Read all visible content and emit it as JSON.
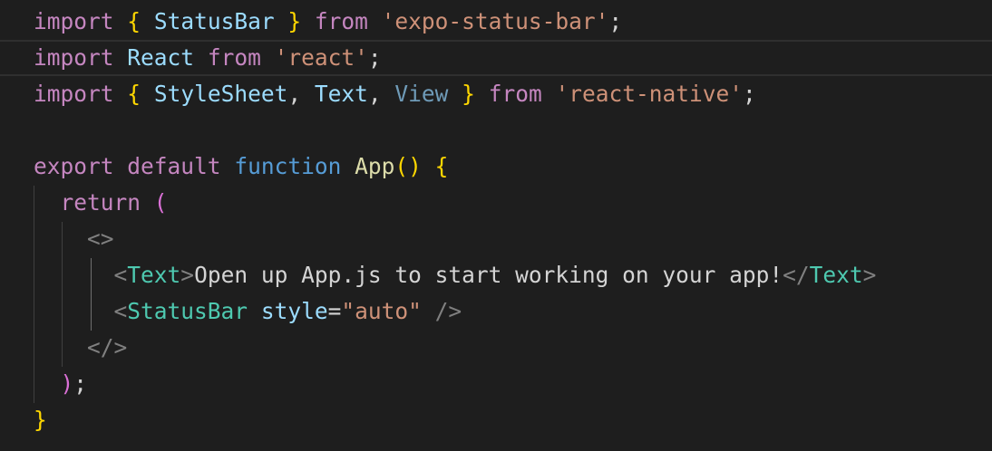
{
  "editor": {
    "language": "javascript",
    "lines": [
      {
        "tokens": [
          {
            "text": "import",
            "type": "kw"
          },
          {
            "text": " ",
            "type": "plain"
          },
          {
            "text": "{",
            "type": "br1"
          },
          {
            "text": " ",
            "type": "plain"
          },
          {
            "text": "StatusBar",
            "type": "var"
          },
          {
            "text": " ",
            "type": "plain"
          },
          {
            "text": "}",
            "type": "br1"
          },
          {
            "text": " ",
            "type": "plain"
          },
          {
            "text": "from",
            "type": "kw"
          },
          {
            "text": " ",
            "type": "plain"
          },
          {
            "text": "'expo-status-bar'",
            "type": "str"
          },
          {
            "text": ";",
            "type": "plain"
          }
        ]
      },
      {
        "tokens": [
          {
            "text": "import",
            "type": "kw"
          },
          {
            "text": " ",
            "type": "plain"
          },
          {
            "text": "React",
            "type": "var"
          },
          {
            "text": " ",
            "type": "plain"
          },
          {
            "text": "from",
            "type": "kw"
          },
          {
            "text": " ",
            "type": "plain"
          },
          {
            "text": "'react'",
            "type": "str"
          },
          {
            "text": ";",
            "type": "plain"
          }
        ]
      },
      {
        "tokens": [
          {
            "text": "import",
            "type": "kw"
          },
          {
            "text": " ",
            "type": "plain"
          },
          {
            "text": "{",
            "type": "br1"
          },
          {
            "text": " ",
            "type": "plain"
          },
          {
            "text": "StyleSheet",
            "type": "var"
          },
          {
            "text": ", ",
            "type": "plain"
          },
          {
            "text": "Text",
            "type": "var"
          },
          {
            "text": ", ",
            "type": "plain"
          },
          {
            "text": "View",
            "type": "dim"
          },
          {
            "text": " ",
            "type": "plain"
          },
          {
            "text": "}",
            "type": "br1"
          },
          {
            "text": " ",
            "type": "plain"
          },
          {
            "text": "from",
            "type": "kw"
          },
          {
            "text": " ",
            "type": "plain"
          },
          {
            "text": "'react-native'",
            "type": "str"
          },
          {
            "text": ";",
            "type": "plain"
          }
        ]
      },
      {
        "tokens": []
      },
      {
        "tokens": [
          {
            "text": "export",
            "type": "kw"
          },
          {
            "text": " ",
            "type": "plain"
          },
          {
            "text": "default",
            "type": "kw"
          },
          {
            "text": " ",
            "type": "plain"
          },
          {
            "text": "function",
            "type": "kb"
          },
          {
            "text": " ",
            "type": "plain"
          },
          {
            "text": "App",
            "type": "fn"
          },
          {
            "text": "()",
            "type": "br1"
          },
          {
            "text": " ",
            "type": "plain"
          },
          {
            "text": "{",
            "type": "br1"
          }
        ]
      },
      {
        "tokens": [
          {
            "text": "  ",
            "type": "plain"
          },
          {
            "text": "return",
            "type": "kw"
          },
          {
            "text": " ",
            "type": "plain"
          },
          {
            "text": "(",
            "type": "br2"
          }
        ]
      },
      {
        "tokens": [
          {
            "text": "    ",
            "type": "plain"
          },
          {
            "text": "<>",
            "type": "pun"
          }
        ]
      },
      {
        "tokens": [
          {
            "text": "      ",
            "type": "plain"
          },
          {
            "text": "<",
            "type": "pun"
          },
          {
            "text": "Text",
            "type": "tag"
          },
          {
            "text": ">",
            "type": "pun"
          },
          {
            "text": "Open up App.js to start working on your app!",
            "type": "txt"
          },
          {
            "text": "</",
            "type": "pun"
          },
          {
            "text": "Text",
            "type": "tag"
          },
          {
            "text": ">",
            "type": "pun"
          }
        ]
      },
      {
        "tokens": [
          {
            "text": "      ",
            "type": "plain"
          },
          {
            "text": "<",
            "type": "pun"
          },
          {
            "text": "StatusBar",
            "type": "tag"
          },
          {
            "text": " ",
            "type": "plain"
          },
          {
            "text": "style",
            "type": "var"
          },
          {
            "text": "=",
            "type": "plain"
          },
          {
            "text": "\"auto\"",
            "type": "str"
          },
          {
            "text": " ",
            "type": "plain"
          },
          {
            "text": "/>",
            "type": "pun"
          }
        ]
      },
      {
        "tokens": [
          {
            "text": "    ",
            "type": "plain"
          },
          {
            "text": "</>",
            "type": "pun"
          }
        ]
      },
      {
        "tokens": [
          {
            "text": "  ",
            "type": "plain"
          },
          {
            "text": ")",
            "type": "br2"
          },
          {
            "text": ";",
            "type": "plain"
          }
        ]
      },
      {
        "tokens": [
          {
            "text": "}",
            "type": "br1"
          }
        ]
      }
    ]
  }
}
